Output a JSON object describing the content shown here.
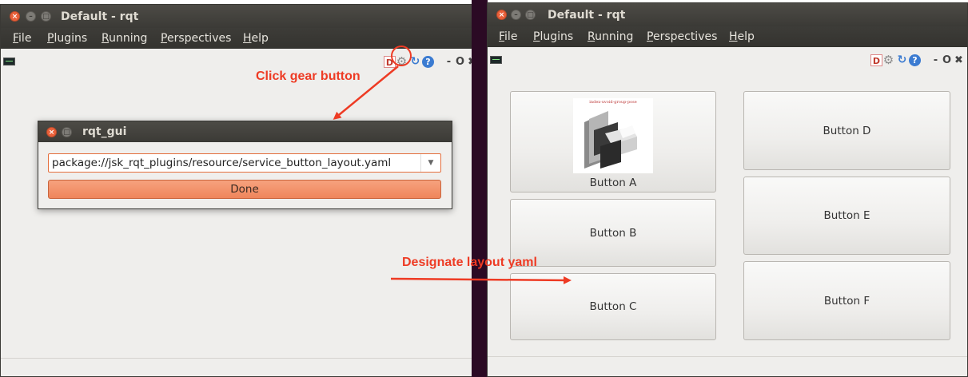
{
  "left_window": {
    "title": "Default - rqt",
    "menu": [
      "File",
      "Plugins",
      "Running",
      "Perspectives",
      "Help"
    ],
    "toolbar_icons": [
      "d-icon",
      "gear-icon",
      "reload-icon",
      "help-icon",
      "minimize-dash-icon",
      "float-icon",
      "close-x-icon"
    ],
    "toolbar_text": {
      "d": "D",
      "dash": "-",
      "o": "O"
    }
  },
  "dialog": {
    "title": "rqt_gui",
    "combo_value": "package://jsk_rqt_plugins/resource/service_button_layout.yaml",
    "done_label": "Done"
  },
  "right_window": {
    "title": "Default - rqt",
    "menu": [
      "File",
      "Plugins",
      "Running",
      "Perspectives",
      "Help"
    ],
    "toolbar_text": {
      "d": "D",
      "dash": "-",
      "o": "O"
    },
    "buttons": [
      {
        "label": "Button A",
        "has_image": true,
        "image_caption": "index-uvoid-group-pose"
      },
      {
        "label": "Button B"
      },
      {
        "label": "Button C"
      },
      {
        "label": "Button D"
      },
      {
        "label": "Button E"
      },
      {
        "label": "Button F"
      }
    ]
  },
  "annotations": {
    "click_gear": "Click gear button",
    "designate_layout": "Designate layout yaml",
    "color": "#ee3b24"
  }
}
